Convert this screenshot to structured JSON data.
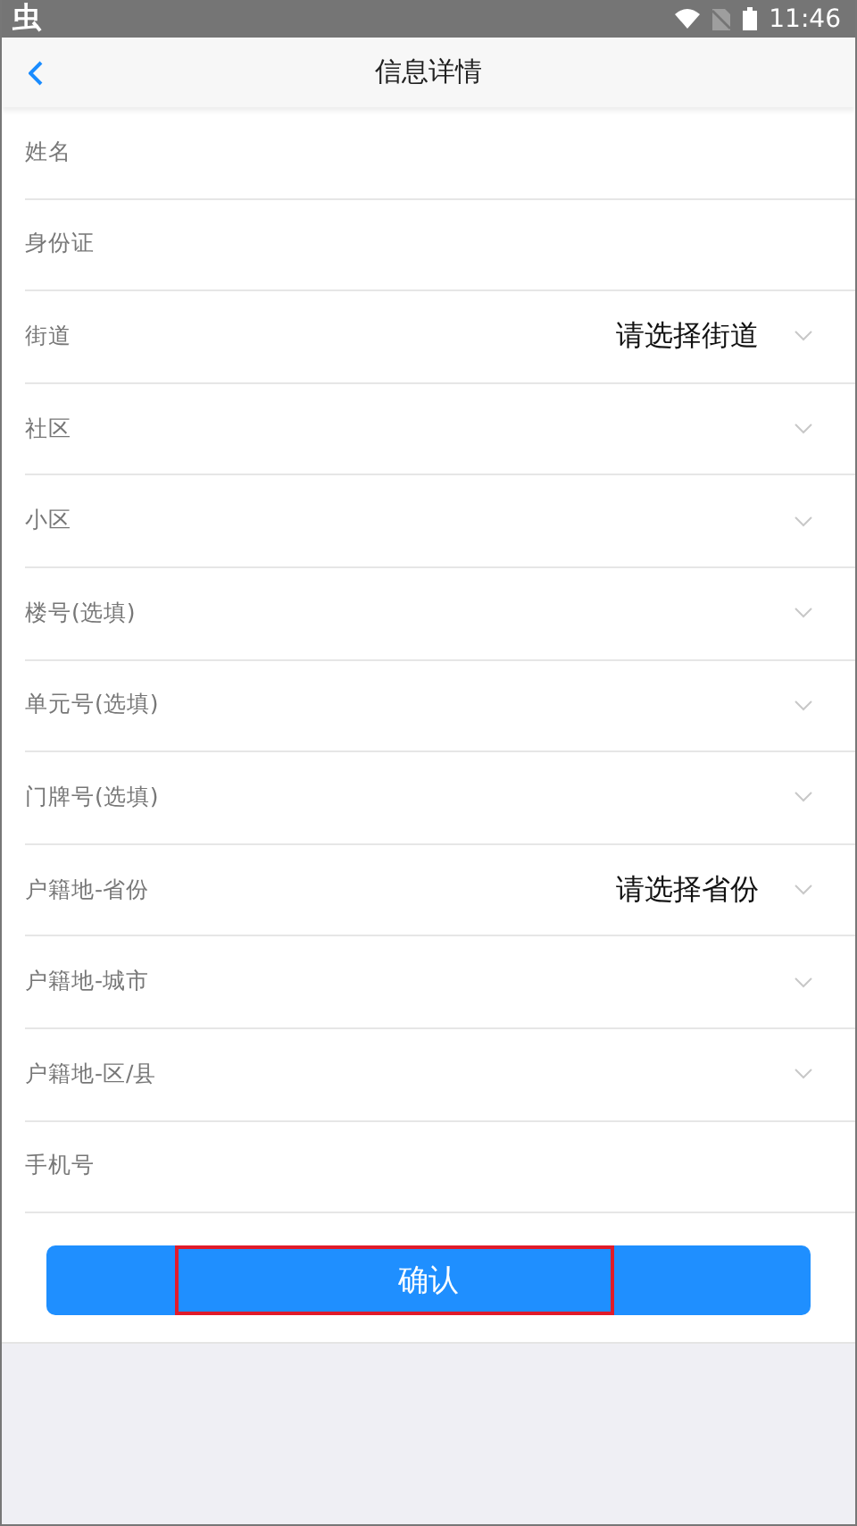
{
  "status_bar": {
    "app_glyph": "虫",
    "time": "11:46"
  },
  "header": {
    "title": "信息详情"
  },
  "fields": [
    {
      "label": "姓名",
      "kind": "text"
    },
    {
      "label": "身份证",
      "kind": "text"
    },
    {
      "label": "街道",
      "kind": "select",
      "value": "请选择街道"
    },
    {
      "label": "社区",
      "kind": "select"
    },
    {
      "label": "小区",
      "kind": "select"
    },
    {
      "label": "楼号(选填)",
      "kind": "select"
    },
    {
      "label": "单元号(选填)",
      "kind": "select"
    },
    {
      "label": "门牌号(选填)",
      "kind": "select"
    },
    {
      "label": "户籍地-省份",
      "kind": "select",
      "value": "请选择省份"
    },
    {
      "label": "户籍地-城市",
      "kind": "select"
    },
    {
      "label": "户籍地-区/县",
      "kind": "select"
    },
    {
      "label": "手机号",
      "kind": "text"
    }
  ],
  "confirm_button": {
    "label": "确认",
    "highlighted": true
  }
}
